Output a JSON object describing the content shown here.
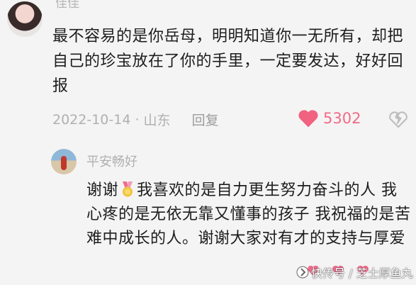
{
  "comment": {
    "username": "佳佳",
    "text": "最不容易的是你岳母，明明知道你一无所有，却把自己的珍宝放在了你的手里，一定要发达，好好回报",
    "date": "2022-10-14",
    "location": "山东",
    "reply_label": "回复",
    "like_count": "5302",
    "like_color": "#f26a87"
  },
  "reply": {
    "username": "平安畅好",
    "text_part1": "谢谢",
    "text_part2": "我喜欢的是自力更生努力奋斗的人 我心疼的是无依无靠又懂事的孩子 我祝福的是苦难中成长的人。谢谢大家对有才的支持与厚爱"
  },
  "watermark": {
    "text": "快传号 / 芝士厚鱼丸"
  },
  "icons": [
    "heart-icon",
    "dislike-icon",
    "medal-icon",
    "watermark-logo-icon"
  ]
}
